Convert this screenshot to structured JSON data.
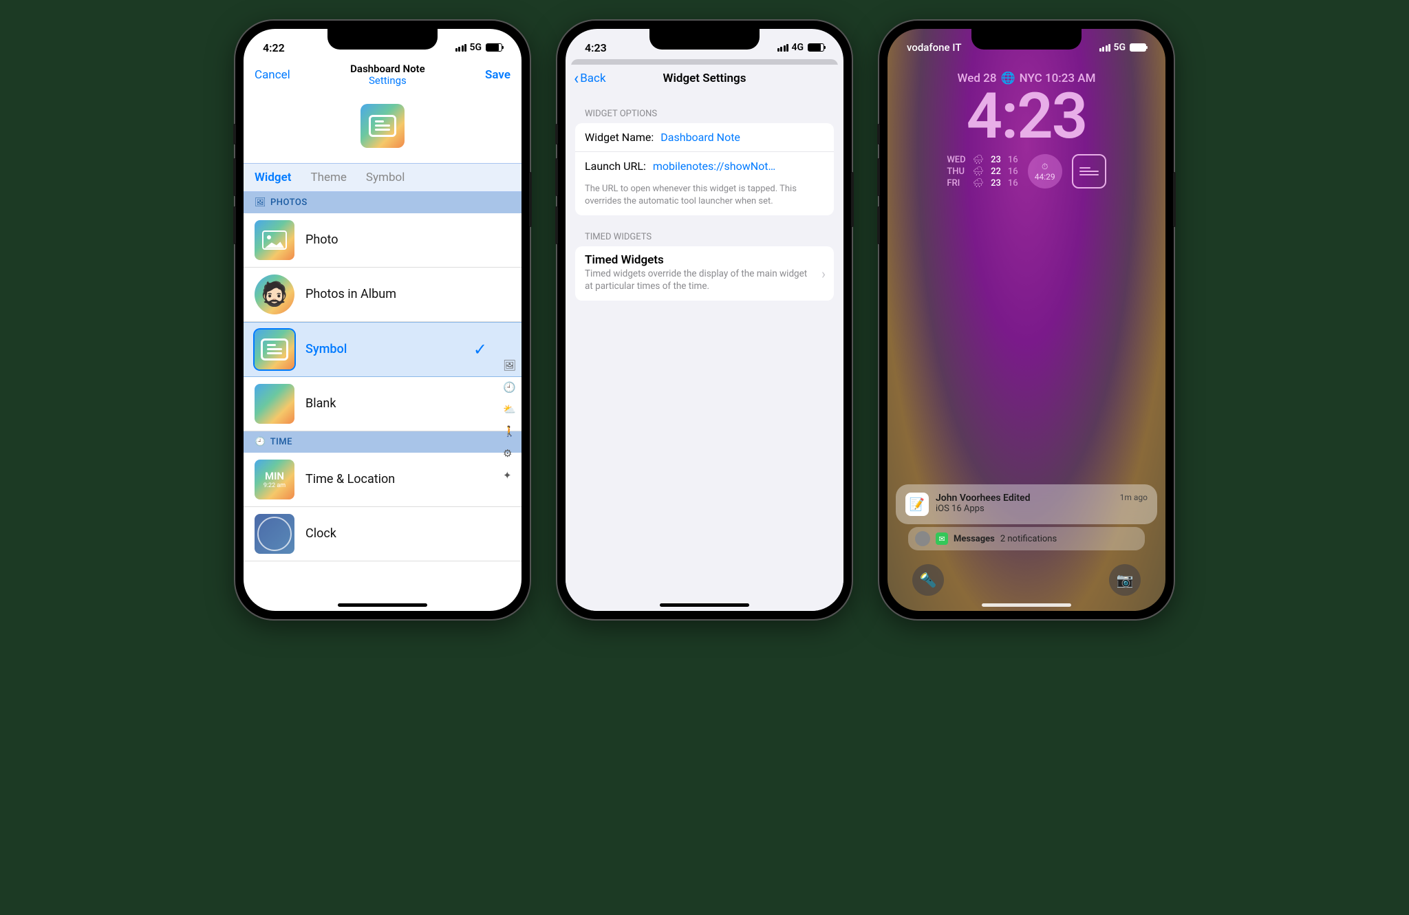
{
  "phone1": {
    "status": {
      "time": "4:22",
      "net": "5G"
    },
    "nav": {
      "cancel": "Cancel",
      "title": "Dashboard Note",
      "subtitle": "Settings",
      "save": "Save"
    },
    "tabs": {
      "widget": "Widget",
      "theme": "Theme",
      "symbol": "Symbol"
    },
    "sections": {
      "photos": "PHOTOS",
      "time": "TIME"
    },
    "rows": {
      "photo": "Photo",
      "photos_in_album": "Photos in Album",
      "symbol": "Symbol",
      "blank": "Blank",
      "time_location": "Time & Location",
      "clock": "Clock"
    },
    "min_tile": {
      "top": "MIN",
      "bottom": "9:22 am"
    }
  },
  "phone2": {
    "status": {
      "time": "4:23",
      "net": "4G"
    },
    "back": "Back",
    "title": "Widget Settings",
    "group_widget_options": "WIDGET OPTIONS",
    "widget_name_label": "Widget Name:",
    "widget_name_value": "Dashboard Note",
    "launch_url_label": "Launch URL:",
    "launch_url_value": "mobilenotes://showNot…",
    "launch_url_footer": "The URL to open whenever this widget is tapped. This overrides the automatic tool launcher when set.",
    "group_timed": "TIMED WIDGETS",
    "timed_title": "Timed Widgets",
    "timed_desc": "Timed widgets override the display of the main widget at particular times of the time."
  },
  "phone3": {
    "status": {
      "carrier": "vodafone IT",
      "net": "5G"
    },
    "date": {
      "day": "Wed 28",
      "tz": "NYC 10:23 AM"
    },
    "time": "4:23",
    "forecast": [
      {
        "day": "WED",
        "hi": "23",
        "lo": "16"
      },
      {
        "day": "THU",
        "hi": "22",
        "lo": "16"
      },
      {
        "day": "FRI",
        "hi": "23",
        "lo": "16"
      }
    ],
    "timer": "44:29",
    "notif": {
      "title": "John Voorhees Edited",
      "sub": "iOS 16 Apps",
      "time": "1m ago"
    },
    "messages": {
      "app": "Messages",
      "count": "2 notifications"
    }
  }
}
